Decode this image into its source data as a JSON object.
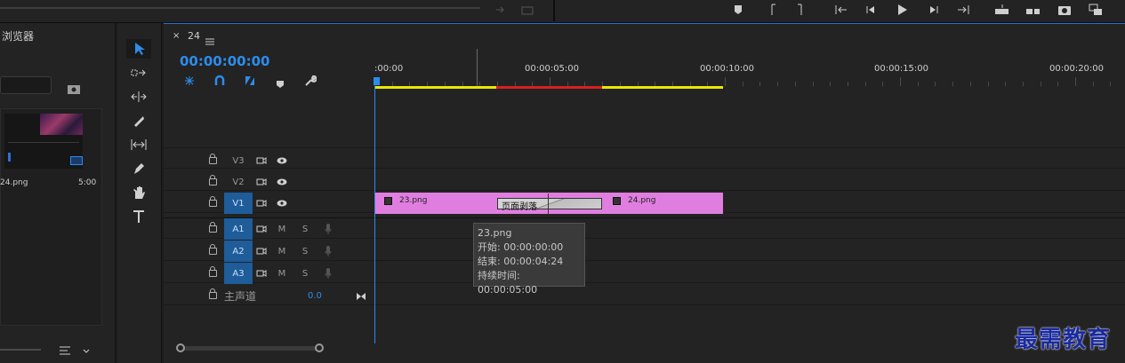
{
  "project_panel": {
    "title_fragment": "浏览器",
    "clip_name": "24.png",
    "clip_duration": "5:00"
  },
  "timeline": {
    "sequence_name": "24",
    "timecode": "00:00:00:00",
    "ruler_labels": [
      ":00:00",
      "00:00:05:00",
      "00:00:10:00",
      "00:00:15:00",
      "00:00:20:00"
    ],
    "video_tracks": [
      {
        "label": "V3",
        "targeted": false
      },
      {
        "label": "V2",
        "targeted": false
      },
      {
        "label": "V1",
        "targeted": true
      }
    ],
    "audio_tracks": [
      {
        "label": "A1",
        "m": "M",
        "s": "S"
      },
      {
        "label": "A2",
        "m": "M",
        "s": "S"
      },
      {
        "label": "A3",
        "m": "M",
        "s": "S"
      }
    ],
    "master": {
      "label": "主声道",
      "value": "0.0"
    },
    "clips": [
      {
        "name": "23.png"
      },
      {
        "name": "24.png"
      }
    ],
    "transition": {
      "name": "页面剥落"
    },
    "tooltip": {
      "title": "23.png",
      "start": "开始: 00:00:00:00",
      "end": "结束: 00:00:04:24",
      "duration": "持续时间: 00:00:05:00"
    },
    "clip_color": "#e07ee0",
    "accent": "#2d8ceb"
  },
  "watermark": "最需教育"
}
